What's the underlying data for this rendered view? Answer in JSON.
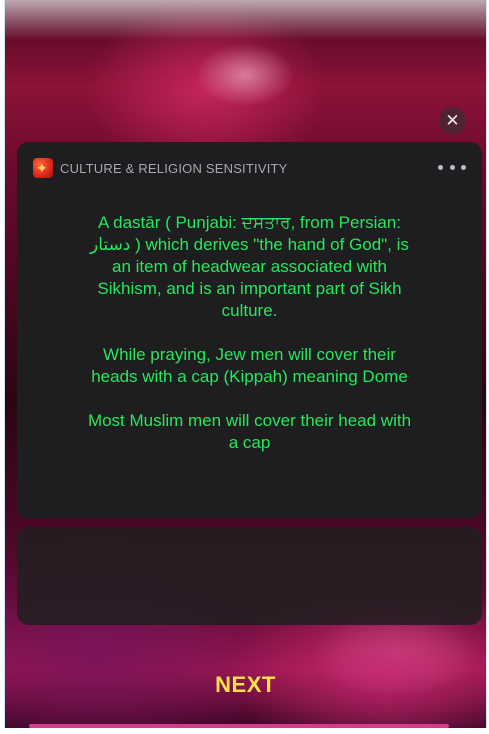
{
  "notification": {
    "app_name": "CULTURE & RELIGION SENSITIVITY",
    "app_icon": "cultural-app-icon",
    "more_icon": "ellipsis-icon",
    "close_icon": "close-icon",
    "close_label": "✕",
    "paragraphs": [
      "A dastār ( Punjabi: ਦਸਤਾਰ, from Persian: دستار ) which derives \"the hand of God\", is an item of headwear associated with Sikhism, and is an important part of Sikh culture.",
      "While praying, Jew men will cover their heads with a cap (Kippah) meaning Dome",
      "Most Muslim men will cover their head with a cap"
    ],
    "text_color": "#27e65c"
  },
  "actions": {
    "next_label": "NEXT",
    "next_color": "#ffe34a"
  }
}
